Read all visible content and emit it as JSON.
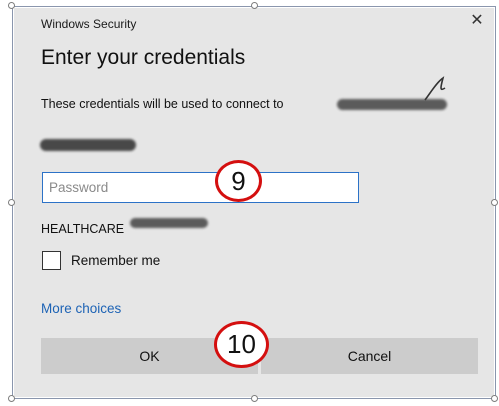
{
  "dialog": {
    "window_title": "Windows Security",
    "close_symbol": "✕",
    "heading": "Enter your credentials",
    "description": "These credentials will be used to connect to",
    "password_placeholder": "Password",
    "domain_prefix": "HEALTHCARE",
    "remember_label": "Remember me",
    "remember_checked": false,
    "more_choices": "More choices",
    "ok_label": "OK",
    "cancel_label": "Cancel"
  },
  "annotations": {
    "step_password": "9",
    "step_ok": "10",
    "badge_color": "#d40f0f"
  },
  "colors": {
    "dialog_background": "#e6e6e6",
    "field_border": "#2c72c7",
    "link": "#1d63b5",
    "button": "#cccccc"
  }
}
